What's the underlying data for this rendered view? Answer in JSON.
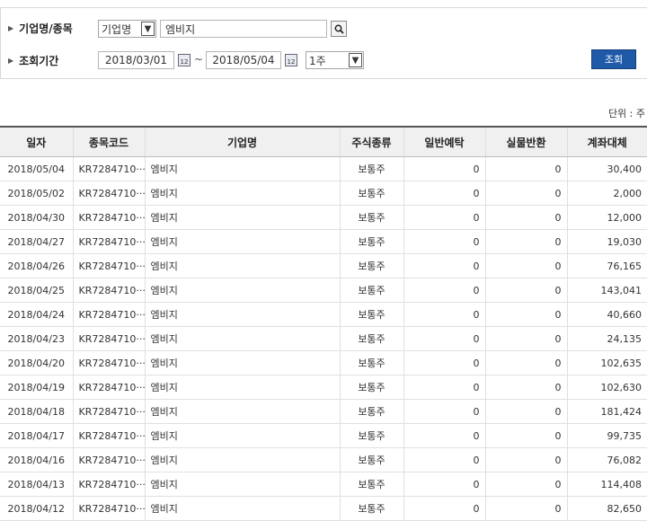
{
  "search": {
    "label_company": "기업명/종목",
    "select_type": "기업명",
    "company_value": "엠비지",
    "label_period": "조회기간",
    "date_from": "2018/03/01",
    "tilde": "~",
    "date_to": "2018/05/04",
    "period_select": "1주",
    "query_button": "조회"
  },
  "unit_label": "단위 : 주",
  "table": {
    "headers": [
      "일자",
      "종목코드",
      "기업명",
      "주식종류",
      "일반예탁",
      "실물반환",
      "계좌대체"
    ],
    "rows": [
      [
        "2018/05/04",
        "KR7284710···",
        "엠비지",
        "보통주",
        "0",
        "0",
        "30,400"
      ],
      [
        "2018/05/02",
        "KR7284710···",
        "엠비지",
        "보통주",
        "0",
        "0",
        "2,000"
      ],
      [
        "2018/04/30",
        "KR7284710···",
        "엠비지",
        "보통주",
        "0",
        "0",
        "12,000"
      ],
      [
        "2018/04/27",
        "KR7284710···",
        "엠비지",
        "보통주",
        "0",
        "0",
        "19,030"
      ],
      [
        "2018/04/26",
        "KR7284710···",
        "엠비지",
        "보통주",
        "0",
        "0",
        "76,165"
      ],
      [
        "2018/04/25",
        "KR7284710···",
        "엠비지",
        "보통주",
        "0",
        "0",
        "143,041"
      ],
      [
        "2018/04/24",
        "KR7284710···",
        "엠비지",
        "보통주",
        "0",
        "0",
        "40,660"
      ],
      [
        "2018/04/23",
        "KR7284710···",
        "엠비지",
        "보통주",
        "0",
        "0",
        "24,135"
      ],
      [
        "2018/04/20",
        "KR7284710···",
        "엠비지",
        "보통주",
        "0",
        "0",
        "102,635"
      ],
      [
        "2018/04/19",
        "KR7284710···",
        "엠비지",
        "보통주",
        "0",
        "0",
        "102,630"
      ],
      [
        "2018/04/18",
        "KR7284710···",
        "엠비지",
        "보통주",
        "0",
        "0",
        "181,424"
      ],
      [
        "2018/04/17",
        "KR7284710···",
        "엠비지",
        "보통주",
        "0",
        "0",
        "99,735"
      ],
      [
        "2018/04/16",
        "KR7284710···",
        "엠비지",
        "보통주",
        "0",
        "0",
        "76,082"
      ],
      [
        "2018/04/13",
        "KR7284710···",
        "엠비지",
        "보통주",
        "0",
        "0",
        "114,408"
      ],
      [
        "2018/04/12",
        "KR7284710···",
        "엠비지",
        "보통주",
        "0",
        "0",
        "82,650"
      ]
    ]
  },
  "colors": {
    "query_button": "#1f5aa8",
    "header_bg": "#f0f0f0"
  },
  "icons": {
    "search": "magnifier-icon",
    "calendar": "calendar-icon",
    "dropdown": "chevron-down-icon"
  }
}
